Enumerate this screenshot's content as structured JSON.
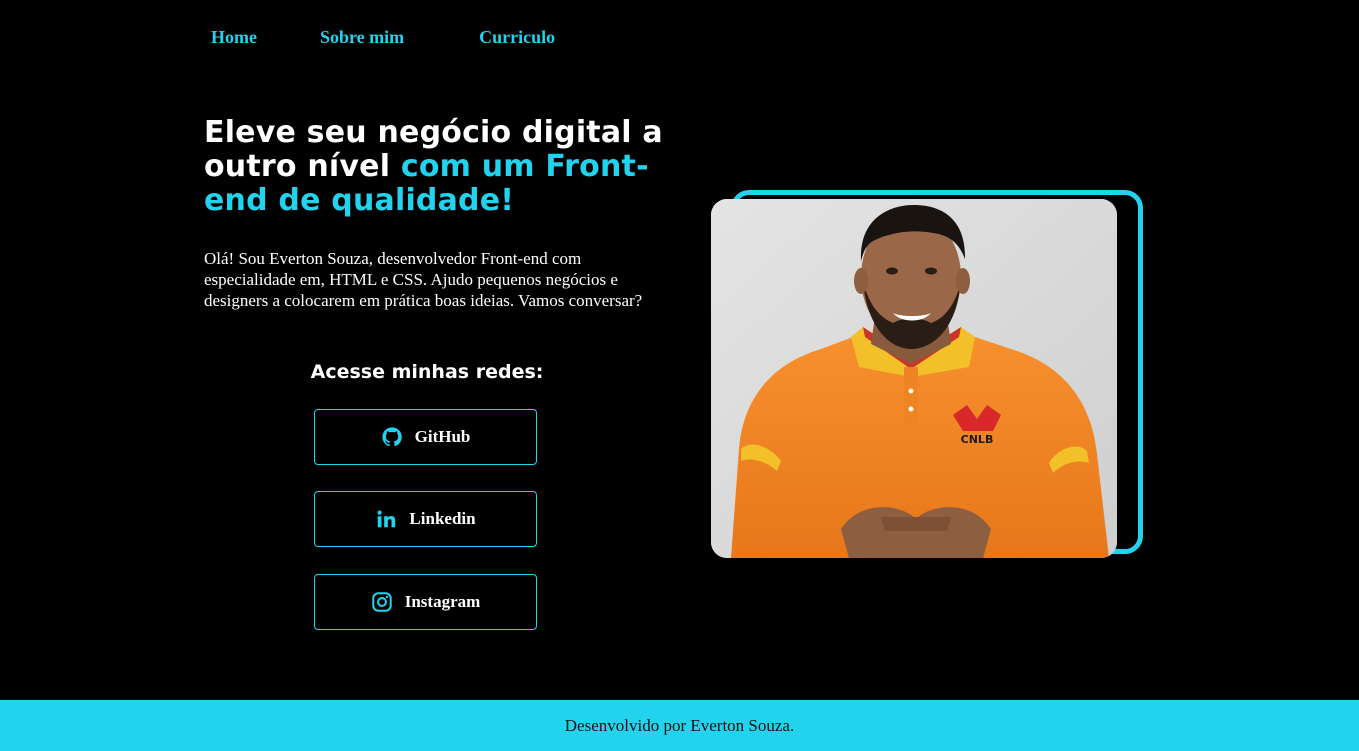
{
  "nav": {
    "items": [
      {
        "label": "Home"
      },
      {
        "label": "Sobre mim"
      },
      {
        "label": "Curriculo"
      }
    ]
  },
  "hero": {
    "headline_white": "Eleve seu negócio digital a outro nível",
    "headline_blue": "com um Front-end de qualidade!",
    "intro": "Olá! Sou Everton Souza, desenvolvedor Front-end com especialidade em, HTML e CSS. Ajudo pequenos negócios e designers a colocarem em prática boas ideias. Vamos conversar?",
    "redes_title": "Acesse minhas redes:"
  },
  "social": [
    {
      "label": "GitHub",
      "icon": "github-icon"
    },
    {
      "label": "Linkedin",
      "icon": "linkedin-icon"
    },
    {
      "label": "Instagram",
      "icon": "instagram-icon"
    }
  ],
  "photo": {
    "shirt_badge": "CNLB"
  },
  "footer": {
    "text": "Desenvolvido por Everton Souza."
  },
  "colors": {
    "accent": "#22d3ee",
    "background": "#000000",
    "text": "#ffffff"
  }
}
